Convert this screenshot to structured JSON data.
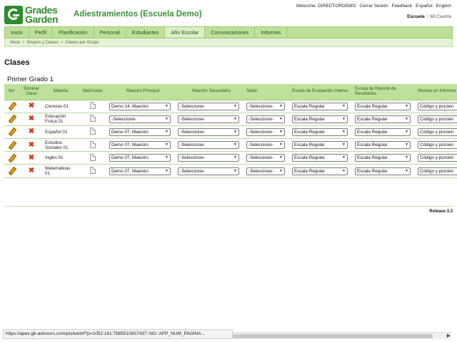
{
  "brand": {
    "line1": "Grades",
    "line2": "Garden"
  },
  "app_title": "Adiestramientos (Escuela Demo)",
  "top_links": [
    "Welcome: DIRECTORDEMO",
    "Cerrar Sesión",
    "Feedback",
    "Español",
    "English"
  ],
  "scope": {
    "active": "Escuela",
    "separator": "|",
    "other": "Mi Cuenta"
  },
  "nav": [
    "Inicio",
    "Perfil",
    "Planificación",
    "Personal",
    "Estudiantes",
    "Año Escolar",
    "Comunicaciones",
    "Informes"
  ],
  "nav_active_index": 5,
  "breadcrumb": [
    "Inicio",
    "Grupos y Clases",
    "Clases por Grupo"
  ],
  "breadcrumb_separator": ">",
  "page_title": "Clases",
  "section_title": "Primer Grado 1",
  "table": {
    "headers": {
      "ver": "Ver",
      "eliminar": "Eliminar Clase",
      "materia": "Materia",
      "matriculas": "Matrículas",
      "maestro_principal": "Maestro Principal",
      "maestro_secundario": "Maestro Secundario",
      "salon": "Salón",
      "escala_interna": "Escala de Evaluación Interna",
      "escala_reporte": "Escala de Reporte de Resultados",
      "mostrar": "Mostrar en Informes de No"
    },
    "rows": [
      {
        "materia": "Ciencias 01",
        "maestro_principal": "Demo 14, Maestro",
        "maestro_secundario": "-Seleccione-",
        "salon": "-Seleccione-",
        "escala_interna": "Escala Regular",
        "escala_reporte": "Escala Regular",
        "mostrar": "Código y porcien"
      },
      {
        "materia": "Educación Física 01",
        "maestro_principal": "-Seleccione-",
        "maestro_secundario": "-Seleccione-",
        "salon": "-Seleccione-",
        "escala_interna": "Escala Regular",
        "escala_reporte": "Escala Regular",
        "mostrar": "Código y porcien"
      },
      {
        "materia": "Español 01",
        "maestro_principal": "Demo 07, Maestro",
        "maestro_secundario": "-Seleccione-",
        "salon": "-Seleccione-",
        "escala_interna": "Escala Regular",
        "escala_reporte": "Escala Regular",
        "mostrar": "Código y porcien"
      },
      {
        "materia": "Estudios Sociales 01",
        "maestro_principal": "Demo 07, Maestro",
        "maestro_secundario": "-Seleccione-",
        "salon": "-Seleccione-",
        "escala_interna": "Escala Regular",
        "escala_reporte": "Escala Regular",
        "mostrar": "Código y porcien"
      },
      {
        "materia": "Inglés 01",
        "maestro_principal": "Demo 07, Maestro",
        "maestro_secundario": "-Seleccione-",
        "salon": "-Seleccione-",
        "escala_interna": "Escala Regular",
        "escala_reporte": "Escala Regular",
        "mostrar": "Código y porcien"
      },
      {
        "materia": "Matemáticas 01",
        "maestro_principal": "Demo 07, Maestro",
        "maestro_secundario": "-Seleccione-",
        "salon": "-Seleccione-",
        "escala_interna": "Escala Regular",
        "escala_reporte": "Escala Regular",
        "mostrar": "Código y porcien"
      }
    ]
  },
  "release": "Release 3.3",
  "status_url": "https://apex.gb-advisors.com/pls/web/f?p=1052:161:7985510657437::NO::APP_NUM_PAGINA...",
  "colors": {
    "brand_green": "#2e8b2e",
    "nav_green": "#bfe09a",
    "delete_red": "#d23a1a"
  },
  "icons": {
    "ver": "pencil-icon",
    "eliminar": "delete-x-icon",
    "matriculas": "document-icon"
  }
}
